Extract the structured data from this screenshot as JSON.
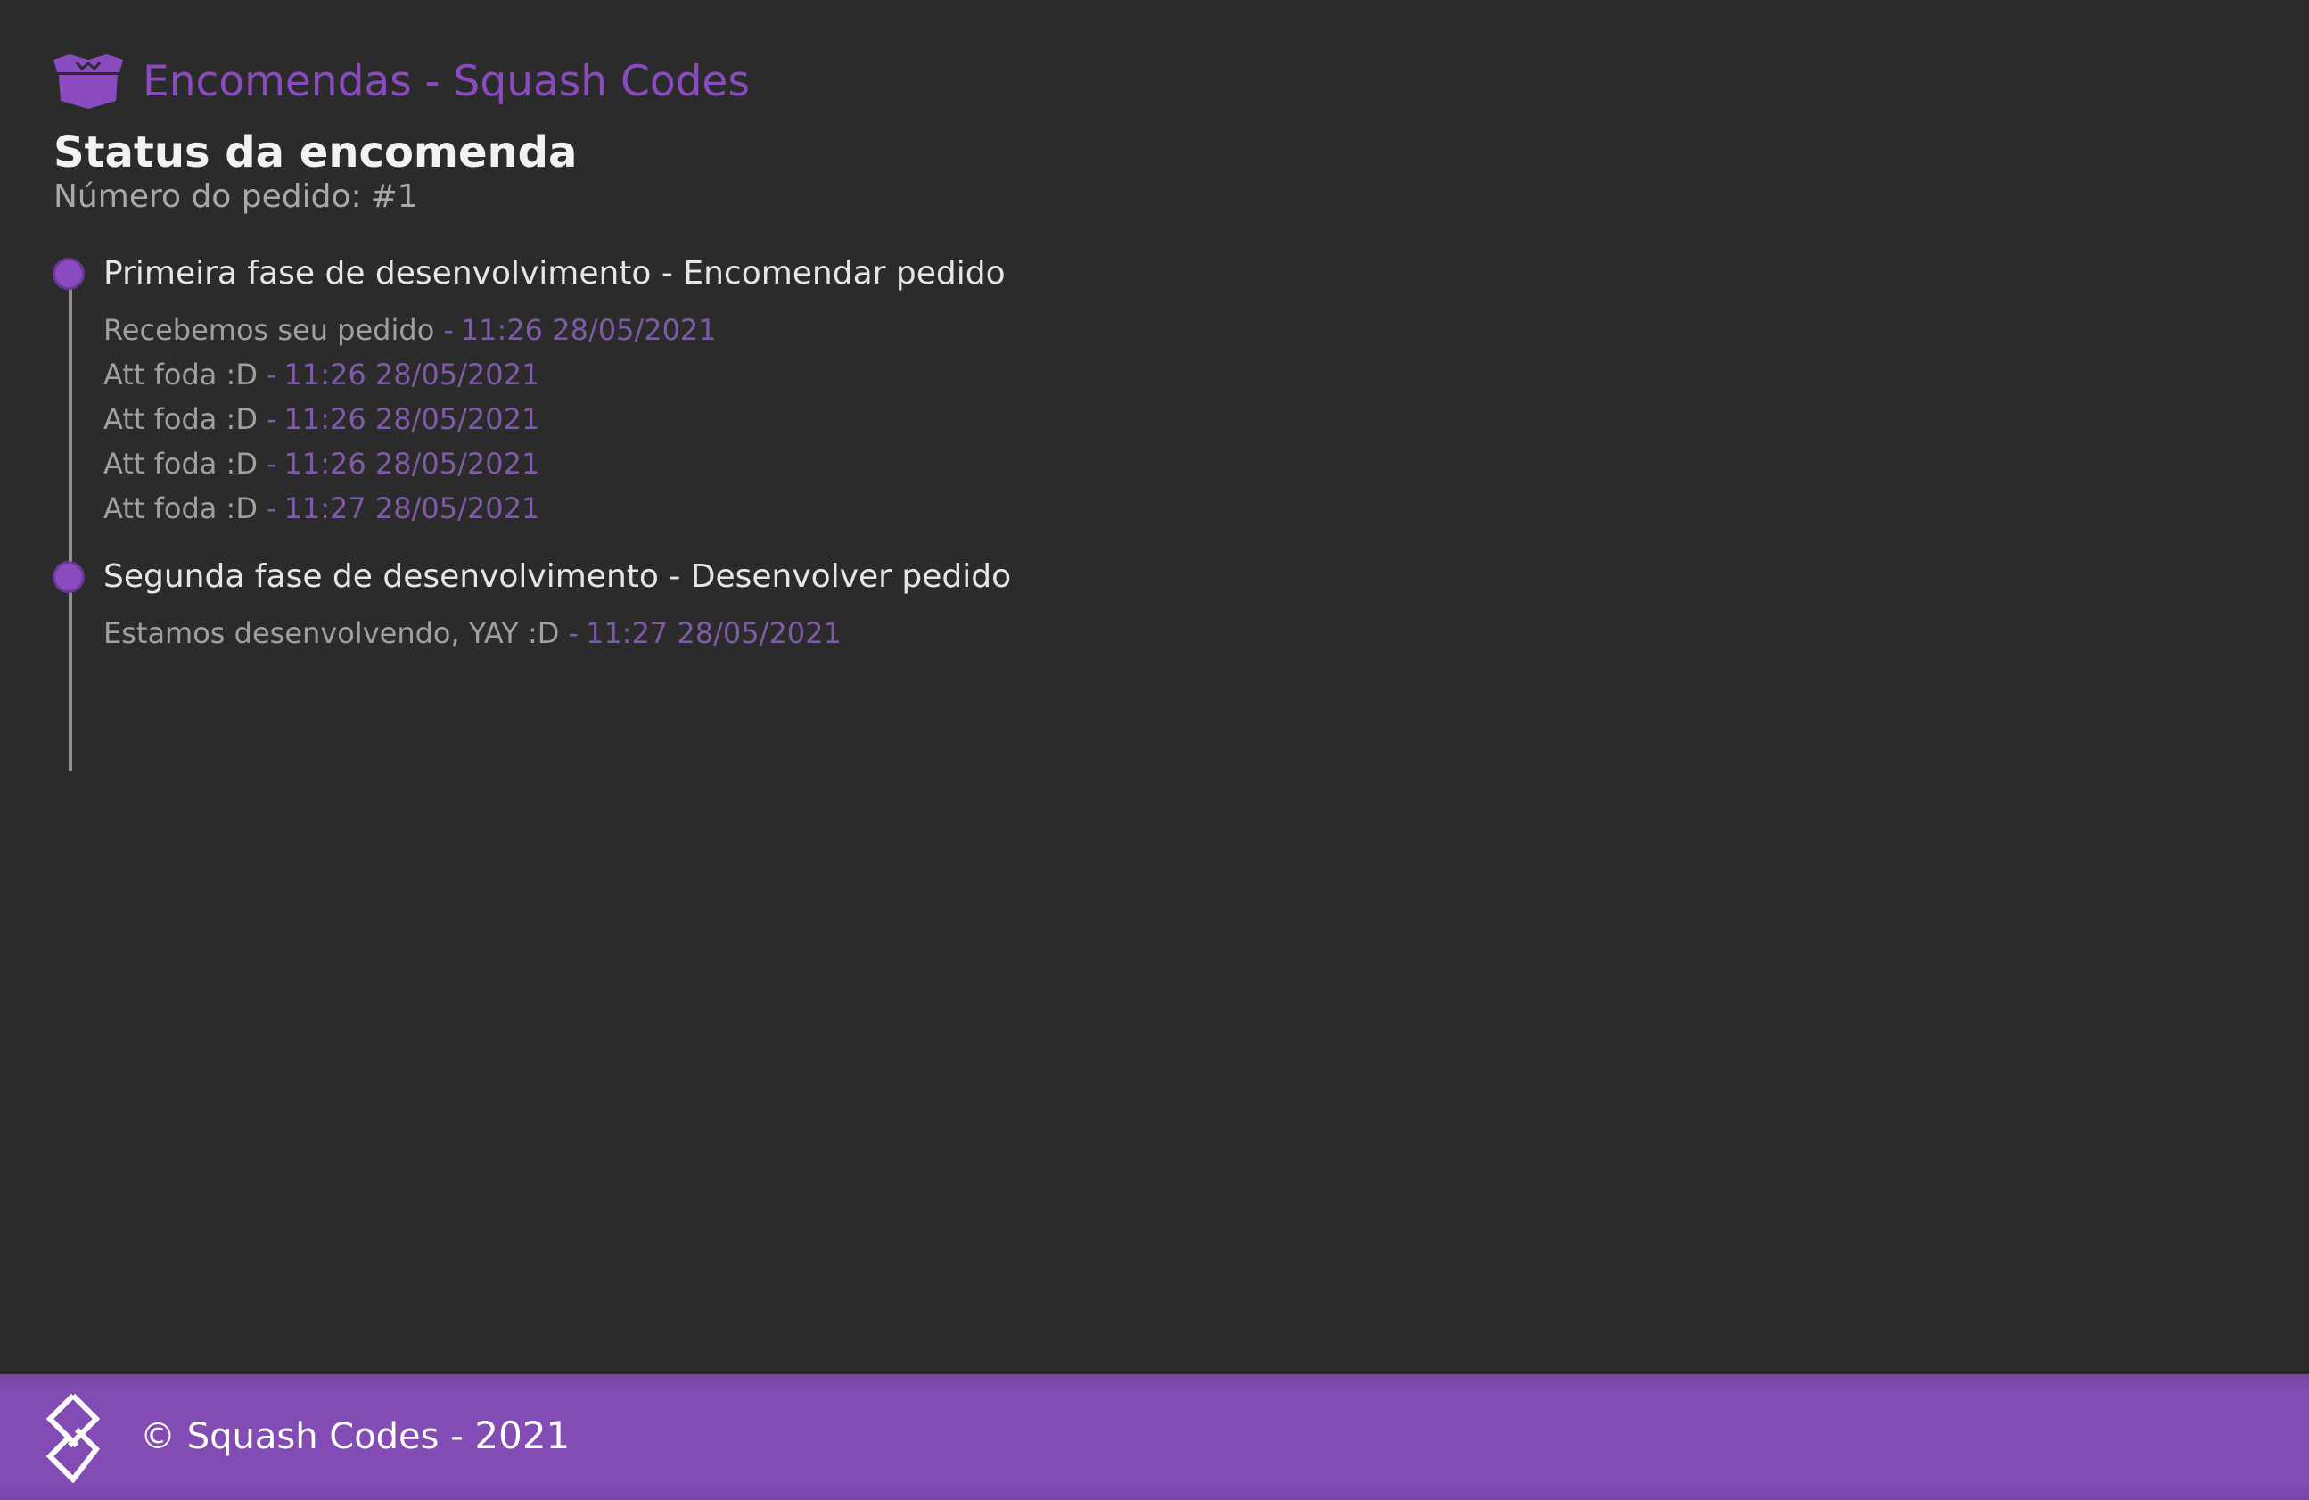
{
  "header": {
    "icon": "box-open-icon",
    "title": "Encomendas - Squash Codes"
  },
  "status": {
    "title": "Status da encomenda",
    "order_label": "Número do pedido:",
    "order_number": "#1"
  },
  "timeline": {
    "phases": [
      {
        "title": "Primeira fase de desenvolvimento - Encomendar pedido",
        "updates": [
          {
            "text": "Recebemos seu pedido",
            "time": "11:26 28/05/2021"
          },
          {
            "text": "Att foda :D",
            "time": "11:26 28/05/2021"
          },
          {
            "text": "Att foda :D",
            "time": "11:26 28/05/2021"
          },
          {
            "text": "Att foda :D",
            "time": "11:26 28/05/2021"
          },
          {
            "text": "Att foda :D",
            "time": "11:27 28/05/2021"
          }
        ]
      },
      {
        "title": "Segunda fase de desenvolvimento - Desenvolver pedido",
        "updates": [
          {
            "text": "Estamos desenvolvendo, YAY :D",
            "time": "11:27 28/05/2021"
          }
        ]
      }
    ]
  },
  "footer": {
    "logo": "squash-codes-logo",
    "copyright": "© Squash Codes -",
    "year": "2021"
  },
  "colors": {
    "accent": "#8a4bc0",
    "background": "#2b2b2b",
    "footer": "#834cb4"
  }
}
